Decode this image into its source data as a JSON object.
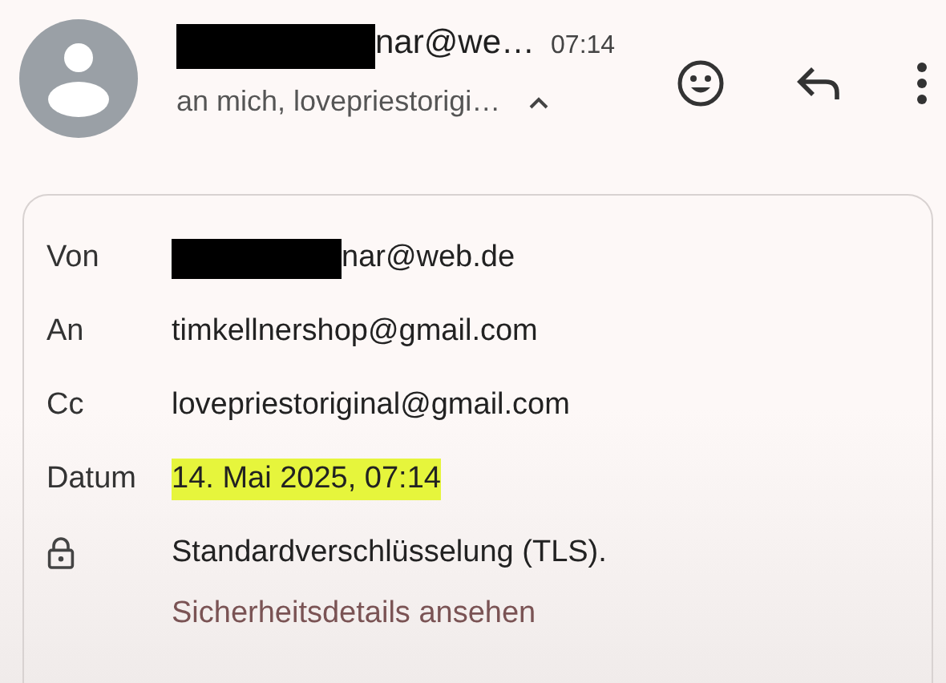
{
  "header": {
    "sender": "nar@we…",
    "sender_redacted": true,
    "time": "07:14",
    "recipients": "an mich, lovepriestorigi…",
    "expanded": true
  },
  "details": {
    "rows": [
      {
        "kind": "field",
        "label": "Von",
        "value": "nar@web.de",
        "redacted": true,
        "highlighted": false
      },
      {
        "kind": "field",
        "label": "An",
        "value": "timkellnershop@gmail.com",
        "redacted": false,
        "highlighted": false
      },
      {
        "kind": "field",
        "label": "Cc",
        "value": "lovepriestoriginal@gmail.com",
        "redacted": false,
        "highlighted": false
      },
      {
        "kind": "field",
        "label": "Datum",
        "value": "14. Mai 2025, 07:14",
        "redacted": false,
        "highlighted": true
      },
      {
        "kind": "security",
        "value": "Standardverschlüsselung (TLS).",
        "link": "Sicherheitsdetails ansehen"
      }
    ]
  }
}
